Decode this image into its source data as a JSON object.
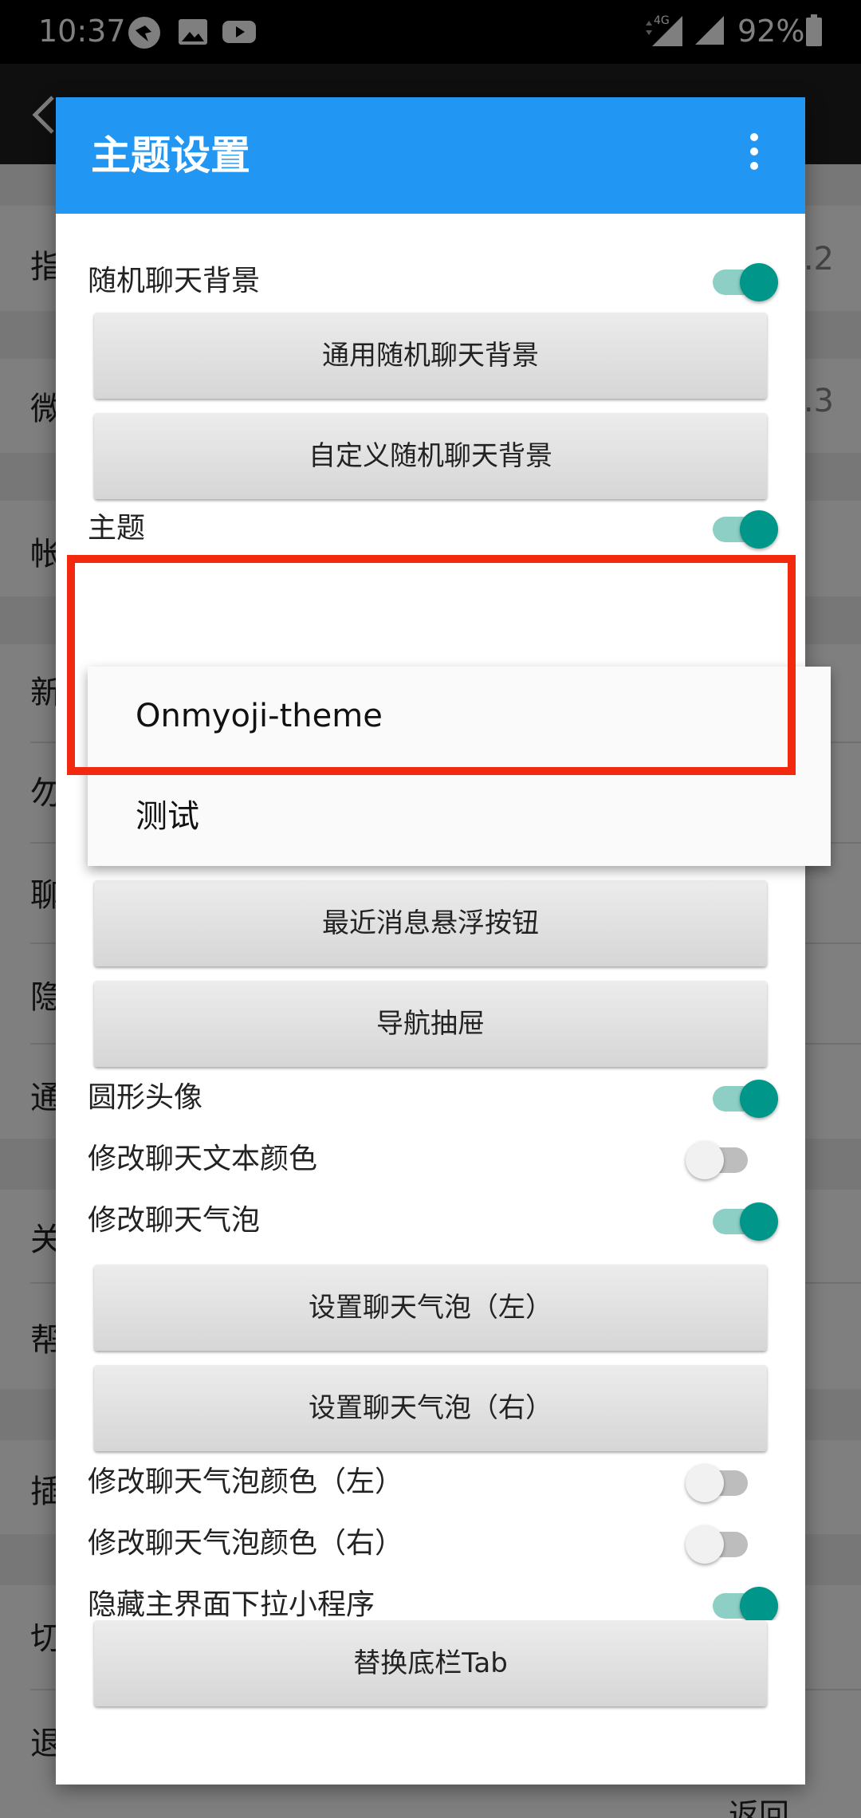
{
  "status_bar": {
    "time": "10:37",
    "network": "4G",
    "battery": "92%"
  },
  "background": {
    "rows": [
      {
        "label": "指",
        "value": ".2"
      },
      {
        "label": "微",
        "value": ".3"
      },
      {
        "label": "帐",
        "value": ""
      },
      {
        "label": "新",
        "value": ""
      },
      {
        "label": "勿",
        "value": ""
      },
      {
        "label": "聊",
        "value": ""
      },
      {
        "label": "隐",
        "value": ""
      },
      {
        "label": "通",
        "value": ""
      },
      {
        "label": "关",
        "value": ""
      },
      {
        "label": "帮",
        "value": ""
      },
      {
        "label": "插",
        "value": ""
      },
      {
        "label": "切",
        "value": ""
      },
      {
        "label": "退",
        "value": ""
      }
    ]
  },
  "dialog": {
    "title": "主题设置",
    "settings": {
      "random_bg": {
        "label": "随机聊天背景",
        "on": true
      },
      "general_random_bg": "通用随机聊天背景",
      "custom_random_bg": "自定义随机聊天背景",
      "theme": {
        "label": "主题",
        "on": true
      },
      "recent_msg_float": "最近消息悬浮按钮",
      "nav_drawer": "导航抽屉",
      "round_avatar": {
        "label": "圆形头像",
        "on": true
      },
      "chat_text_color": {
        "label": "修改聊天文本颜色",
        "on": false
      },
      "chat_bubble": {
        "label": "修改聊天气泡",
        "on": true
      },
      "bubble_left": "设置聊天气泡（左）",
      "bubble_right": "设置聊天气泡（右）",
      "bubble_color_left": {
        "label": "修改聊天气泡颜色（左）",
        "on": false
      },
      "bubble_color_right": {
        "label": "修改聊天气泡颜色（右）",
        "on": false
      },
      "hide_miniprogram": {
        "label": "隐藏主界面下拉小程序",
        "on": true
      },
      "replace_tab": "替换底栏Tab"
    },
    "theme_popup": {
      "items": [
        "Onmyoji-theme",
        "测试"
      ]
    },
    "return_label": "返回"
  },
  "colors": {
    "header": "#2196f3",
    "switch_on": "#00968a",
    "highlight": "#f2280f"
  }
}
